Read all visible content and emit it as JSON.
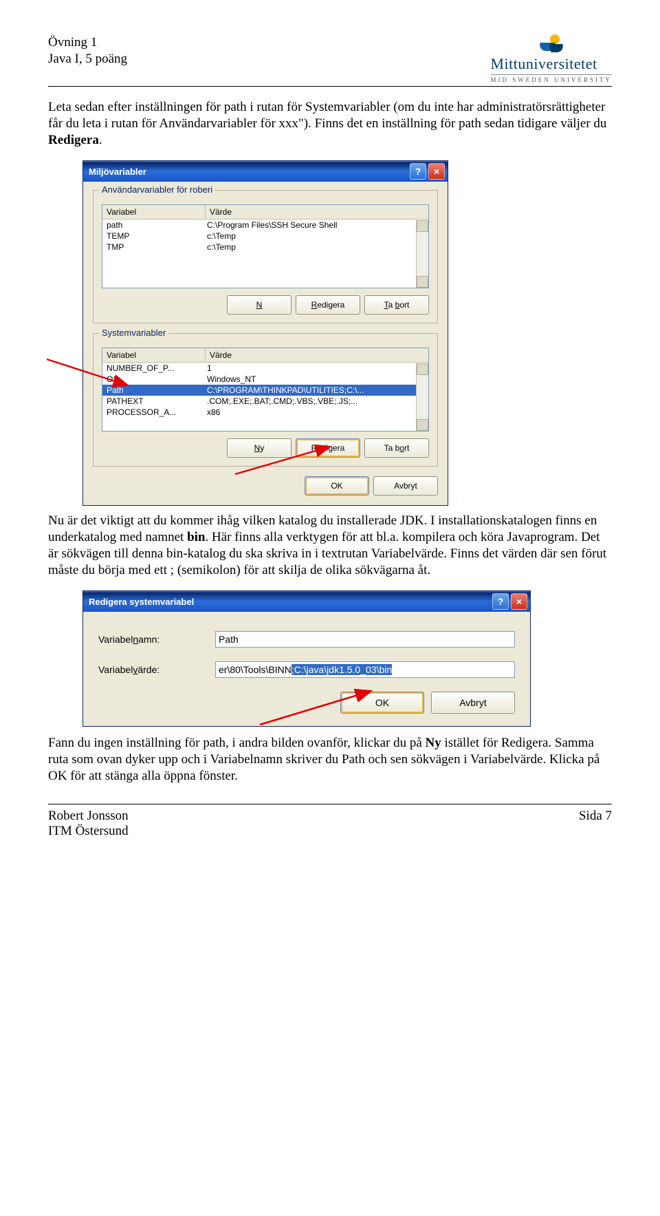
{
  "header": {
    "line1": "Övning 1",
    "line2": "Java I, 5 poäng",
    "logo_text": "Mittuniversitetet",
    "logo_sub": "MID SWEDEN UNIVERSITY"
  },
  "para1_a": "Leta sedan efter inställningen för path i rutan för Systemvariabler (om du inte har administratörsrättigheter får du leta i rutan för Användarvariabler för xxx\"). Finns det en inställning för path sedan tidigare väljer du ",
  "para1_b": "Redigera",
  "para1_c": ".",
  "dialog1": {
    "title": "Miljövariabler",
    "group_user": "Användarvariabler för roberi",
    "group_sys": "Systemvariabler",
    "cols": {
      "c1": "Variabel",
      "c2": "Värde"
    },
    "user_rows": [
      {
        "name": "path",
        "value": "C:\\Program Files\\SSH Secure Shell"
      },
      {
        "name": "TEMP",
        "value": "c:\\Temp"
      },
      {
        "name": "TMP",
        "value": "c:\\Temp"
      }
    ],
    "sys_rows": [
      {
        "name": "NUMBER_OF_P...",
        "value": "1"
      },
      {
        "name": "OS",
        "value": "Windows_NT"
      },
      {
        "name": "Path",
        "value": "C:\\PROGRAM\\THINKPAD\\UTILITIES;C:\\...",
        "selected": true
      },
      {
        "name": "PATHEXT",
        "value": ".COM;.EXE;.BAT;.CMD;.VBS;.VBE;.JS;..."
      },
      {
        "name": "PROCESSOR_A...",
        "value": "x86"
      }
    ],
    "buttons": {
      "ny": "Ny",
      "red": "Redigera",
      "del": "Ta bort",
      "ok": "OK",
      "cancel": "Avbryt"
    }
  },
  "para2_a": "Nu är det viktigt att du kommer ihåg vilken katalog du installerade JDK. I installationskatalogen finns en underkatalog med namnet ",
  "para2_b": "bin",
  "para2_c": ". Här finns alla verktygen för att bl.a. kompilera och köra Javaprogram. Det är sökvägen till denna bin-katalog du ska skriva in i textrutan Variabelvärde. Finns det värden där sen förut måste du börja med ett ; (semikolon) för att skilja de olika sökvägarna åt.",
  "dialog2": {
    "title": "Redigera systemvariabel",
    "label_name": "Variabelnamn:",
    "label_value": "Variabelvärde:",
    "input_name": "Path",
    "input_value_prefix": "er\\80\\Tools\\BINN",
    "input_value_sel": ";C:\\java\\jdk1.5.0_03\\bin",
    "ok": "OK",
    "cancel": "Avbryt"
  },
  "para3_a": "Fann du ingen inställning för path, i andra bilden ovanför, klickar du på ",
  "para3_b": "Ny",
  "para3_c": " istället för Redigera. Samma ruta som ovan dyker upp och i Variabelnamn skriver du Path och sen sökvägen i Variabelvärde. Klicka på OK för att stänga alla öppna fönster.",
  "footer": {
    "left1": "Robert Jonsson",
    "left2": "ITM Östersund",
    "right": "Sida 7"
  }
}
